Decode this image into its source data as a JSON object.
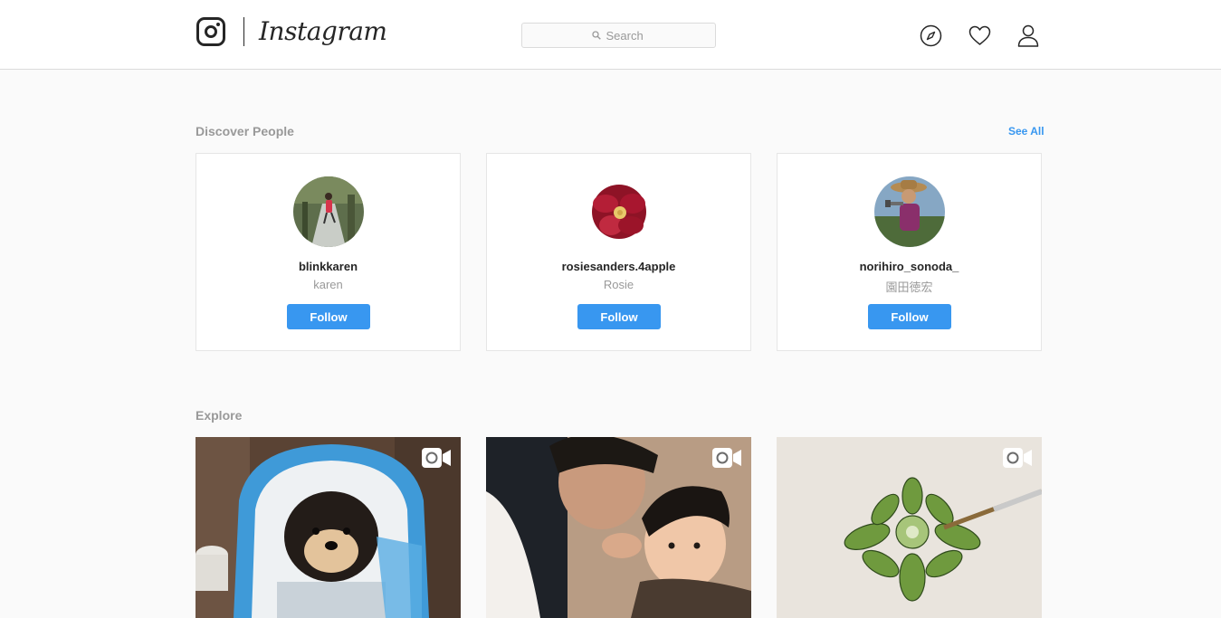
{
  "header": {
    "wordmark": "Instagram",
    "search_placeholder": "Search",
    "icons": [
      "compass-icon",
      "heart-icon",
      "profile-icon"
    ]
  },
  "discover": {
    "title": "Discover People",
    "see_all": "See All",
    "people": [
      {
        "username": "blinkkaren",
        "name": "karen",
        "follow_label": "Follow"
      },
      {
        "username": "rosiesanders.4apple",
        "name": "Rosie",
        "follow_label": "Follow"
      },
      {
        "username": "norihiro_sonoda_",
        "name": "園田徳宏",
        "follow_label": "Follow"
      }
    ]
  },
  "explore": {
    "title": "Explore",
    "tiles": [
      {
        "subject": "puppy in carrier",
        "badge": "video-icon"
      },
      {
        "subject": "father and son",
        "badge": "video-icon"
      },
      {
        "subject": "succulent painting",
        "badge": "video-icon"
      }
    ]
  },
  "colors": {
    "accent": "#3897f0",
    "muted_text": "#999999",
    "border": "#dbdbdb",
    "background": "#fafafa"
  }
}
